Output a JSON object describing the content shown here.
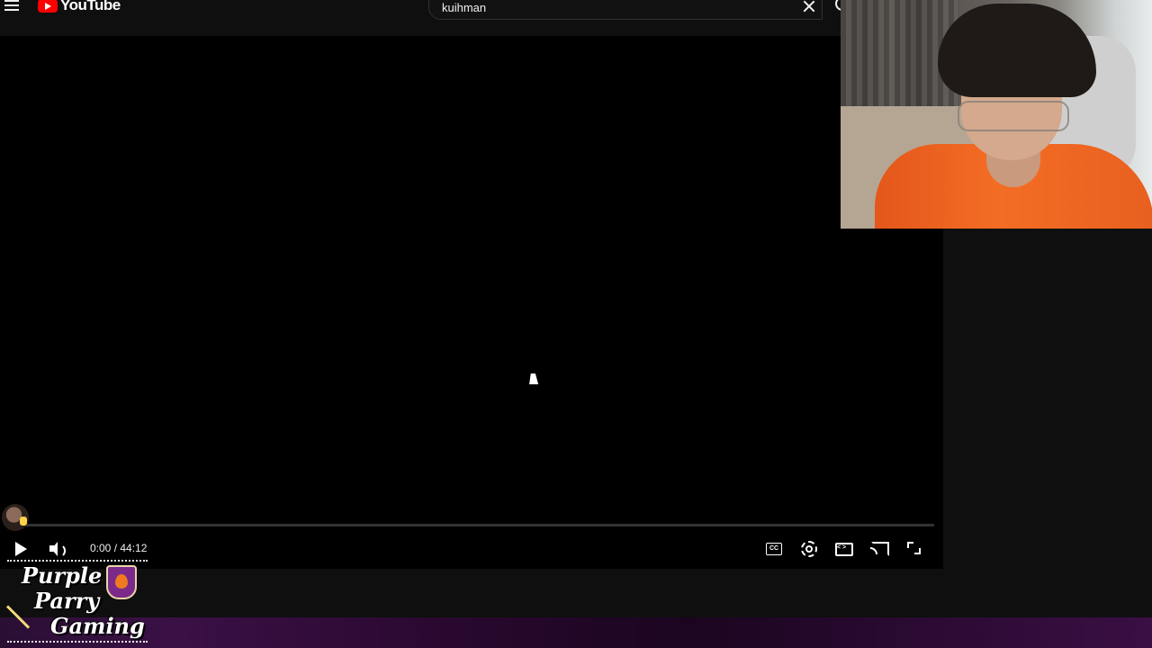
{
  "app": {
    "name": "YouTube"
  },
  "search": {
    "query": "kuihman"
  },
  "player": {
    "time_current": "0:00",
    "time_total": "44:12",
    "time_display": "0:00 / 44:12",
    "progress_fraction": 0
  },
  "overlay": {
    "brand_line_1": "Purple",
    "brand_line_2": "Parry",
    "brand_line_3": "Gaming"
  },
  "icons": {
    "menu": "menu-icon",
    "search": "search-icon",
    "clear": "close-icon",
    "play": "play-icon",
    "volume": "volume-icon",
    "captions": "captions-icon",
    "settings": "gear-icon",
    "theater": "theater-icon",
    "cast": "cast-icon",
    "fullscreen": "fullscreen-icon"
  },
  "colors": {
    "brand_red": "#ff0000",
    "player_bg": "#000000",
    "page_bg": "#0f0f0f",
    "overlay_purple": "#3b1046"
  }
}
